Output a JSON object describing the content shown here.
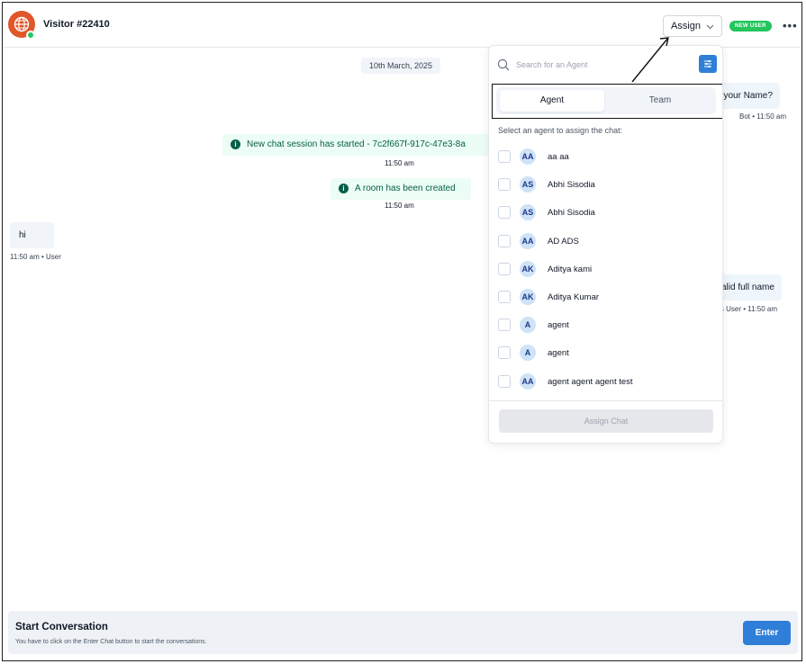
{
  "header": {
    "visitor_name": "Visitor #22410",
    "assign_label": "Assign",
    "new_user_badge": "NEW USER",
    "more_icon": "more-horizontal-icon"
  },
  "chat": {
    "date": "10th March, 2025",
    "system_messages": [
      {
        "text": "New chat session has started - 7c2f667f-917c-47e3-8a",
        "time": "11:50 am"
      },
      {
        "text": "A room has been created",
        "time": "11:50 am"
      }
    ],
    "user_message": {
      "text": "hi",
      "meta": "11:50 am • User"
    },
    "bot_messages": [
      {
        "text": "t's your Name?",
        "meta": "Bot • 11:50 am"
      },
      {
        "text": "valid full name",
        "meta": "ous User • 11:50 am"
      }
    ]
  },
  "assign_panel": {
    "search_placeholder": "Search for an Agent",
    "tabs": [
      "Agent",
      "Team"
    ],
    "active_tab": "Agent",
    "hint": "Select an agent to assign the chat:",
    "agents": [
      {
        "initials": "AA",
        "name": "aa aa"
      },
      {
        "initials": "AS",
        "name": "Abhi Sisodia"
      },
      {
        "initials": "AS",
        "name": "Abhi Sisodia"
      },
      {
        "initials": "AA",
        "name": "AD ADS"
      },
      {
        "initials": "AK",
        "name": "Aditya kami"
      },
      {
        "initials": "AK",
        "name": "Aditya Kumar"
      },
      {
        "initials": "A",
        "name": "agent"
      },
      {
        "initials": "A",
        "name": "agent"
      },
      {
        "initials": "AA",
        "name": "agent agent agent test"
      }
    ],
    "assign_button": "Assign Chat"
  },
  "footer": {
    "title": "Start Conversation",
    "subtitle": "You have to click on the Enter Chat button to start the conversations.",
    "enter_button": "Enter"
  },
  "colors": {
    "accent": "#2f7fd8",
    "online": "#22c55e",
    "avatar_bg": "#e0562b",
    "system_msg_bg": "#ecfdf5"
  }
}
